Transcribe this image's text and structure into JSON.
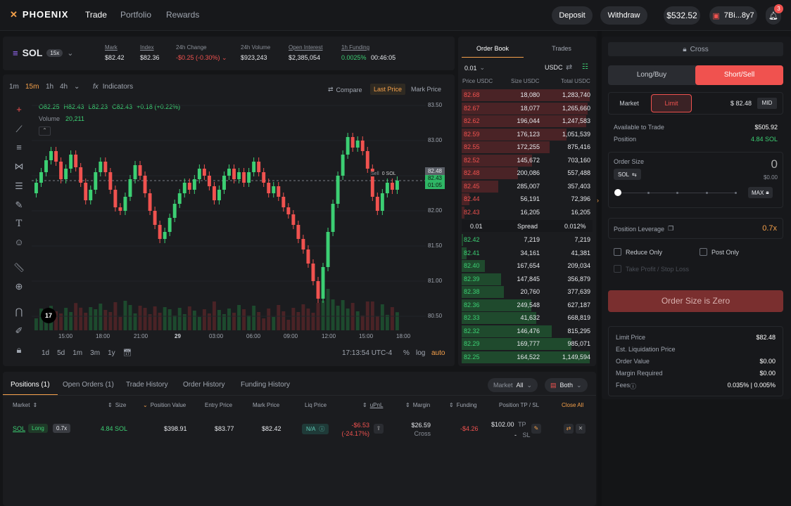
{
  "brand": {
    "name": "PHOENIX",
    "icon": "phoenix-logo-icon"
  },
  "nav": [
    {
      "label": "Trade"
    },
    {
      "label": "Portfolio"
    },
    {
      "label": "Rewards"
    }
  ],
  "top": {
    "deposit": "Deposit",
    "withdraw": "Withdraw",
    "balance": "$532.52",
    "wallet": "7Bi...8y7",
    "notifications": "3"
  },
  "market": {
    "symbol": "SOL",
    "leverage": "15x",
    "stats": [
      {
        "label": "Mark",
        "value": "$82.42"
      },
      {
        "label": "Index",
        "value": "$82.36"
      },
      {
        "label": "24h Change",
        "value": "-$0.25 (-0.30%)"
      },
      {
        "label": "24h Volume",
        "value": "$923,243"
      },
      {
        "label": "Open Interest",
        "value": "$2,385,054"
      },
      {
        "label": "1h Funding",
        "value": "0.0025%",
        "countdown": "00:46:05"
      }
    ]
  },
  "chart": {
    "timeframes": [
      "1m",
      "15m",
      "1h",
      "4h"
    ],
    "active_timeframe": "15m",
    "indicators": "Indicators",
    "compare": "Compare",
    "last_price": "Last Price",
    "mark_price": "Mark Price",
    "ohlc": {
      "o": "O82.25",
      "h": "H82.43",
      "l": "L82.23",
      "c": "C82.43",
      "chg": "+0.18 (+0.22%)"
    },
    "volume_label": "Volume",
    "volume_value": "20,211",
    "position_label": "Sell",
    "position_size": "0 SOL",
    "price_tag": "82.48",
    "last_tag": "82.43",
    "last_countdown": "01:05",
    "ranges": [
      "1d",
      "5d",
      "1m",
      "3m",
      "1y"
    ],
    "clock": "17:13:54 UTC-4",
    "pct": "%",
    "log": "log",
    "auto": "auto",
    "tv_logo": "17"
  },
  "chart_data": {
    "type": "candlestick",
    "y_ticks": [
      "83.50",
      "83.00",
      "82.50",
      "82.00",
      "81.50",
      "81.00",
      "80.50"
    ],
    "x_ticks": [
      "15:00",
      "18:00",
      "21:00",
      "29",
      "03:00",
      "06:00",
      "09:00",
      "12:00",
      "15:00",
      "18:00"
    ],
    "ylim": [
      80.3,
      83.6
    ],
    "series": [
      {
        "o": 82.25,
        "c": 82.4
      },
      {
        "o": 82.4,
        "c": 82.55
      },
      {
        "o": 82.55,
        "c": 82.72
      },
      {
        "o": 82.72,
        "c": 82.85
      },
      {
        "o": 82.85,
        "c": 82.7
      },
      {
        "o": 82.7,
        "c": 82.45
      },
      {
        "o": 82.45,
        "c": 82.6
      },
      {
        "o": 82.6,
        "c": 82.8
      },
      {
        "o": 82.8,
        "c": 82.62
      },
      {
        "o": 82.62,
        "c": 82.4
      },
      {
        "o": 82.4,
        "c": 82.15
      },
      {
        "o": 82.15,
        "c": 82.3
      },
      {
        "o": 82.3,
        "c": 82.55
      },
      {
        "o": 82.55,
        "c": 82.7
      },
      {
        "o": 82.7,
        "c": 82.55
      },
      {
        "o": 82.55,
        "c": 82.3
      },
      {
        "o": 82.3,
        "c": 82.05
      },
      {
        "o": 82.05,
        "c": 82.0
      },
      {
        "o": 82.0,
        "c": 82.2
      },
      {
        "o": 82.2,
        "c": 82.45
      },
      {
        "o": 82.45,
        "c": 82.65
      },
      {
        "o": 82.65,
        "c": 82.5
      },
      {
        "o": 82.5,
        "c": 82.25
      },
      {
        "o": 82.25,
        "c": 82.0
      },
      {
        "o": 82.0,
        "c": 81.8
      },
      {
        "o": 81.8,
        "c": 81.6
      },
      {
        "o": 81.6,
        "c": 81.7
      },
      {
        "o": 81.7,
        "c": 81.9
      },
      {
        "o": 81.9,
        "c": 82.1
      },
      {
        "o": 82.1,
        "c": 82.25
      },
      {
        "o": 82.25,
        "c": 82.4
      },
      {
        "o": 82.4,
        "c": 82.3
      },
      {
        "o": 82.3,
        "c": 82.45
      },
      {
        "o": 82.45,
        "c": 82.6
      },
      {
        "o": 82.6,
        "c": 82.5
      },
      {
        "o": 82.5,
        "c": 82.35
      },
      {
        "o": 82.35,
        "c": 82.15
      },
      {
        "o": 82.15,
        "c": 82.3
      },
      {
        "o": 82.3,
        "c": 82.5
      },
      {
        "o": 82.5,
        "c": 82.6
      },
      {
        "o": 82.6,
        "c": 82.45
      },
      {
        "o": 82.45,
        "c": 82.55
      },
      {
        "o": 82.55,
        "c": 82.4
      },
      {
        "o": 82.4,
        "c": 82.55
      },
      {
        "o": 82.55,
        "c": 82.7
      },
      {
        "o": 82.7,
        "c": 82.55
      },
      {
        "o": 82.55,
        "c": 82.4
      },
      {
        "o": 82.4,
        "c": 82.25
      },
      {
        "o": 82.25,
        "c": 82.35
      },
      {
        "o": 82.35,
        "c": 82.2
      },
      {
        "o": 82.2,
        "c": 82.05
      },
      {
        "o": 82.05,
        "c": 81.95
      },
      {
        "o": 81.95,
        "c": 81.8
      },
      {
        "o": 81.8,
        "c": 81.6
      },
      {
        "o": 81.6,
        "c": 81.45
      },
      {
        "o": 81.45,
        "c": 81.25
      },
      {
        "o": 81.25,
        "c": 81.0
      },
      {
        "o": 81.0,
        "c": 80.75
      },
      {
        "o": 80.75,
        "c": 81.2
      },
      {
        "o": 81.2,
        "c": 81.7
      },
      {
        "o": 81.7,
        "c": 82.1
      },
      {
        "o": 82.1,
        "c": 82.5
      },
      {
        "o": 82.5,
        "c": 82.8
      },
      {
        "o": 82.8,
        "c": 83.05
      },
      {
        "o": 83.05,
        "c": 82.9
      },
      {
        "o": 82.9,
        "c": 83.0
      },
      {
        "o": 83.0,
        "c": 82.85
      },
      {
        "o": 82.85,
        "c": 82.6
      },
      {
        "o": 82.6,
        "c": 82.2
      },
      {
        "o": 82.2,
        "c": 82.0
      },
      {
        "o": 82.0,
        "c": 82.25
      },
      {
        "o": 82.25,
        "c": 82.4
      },
      {
        "o": 82.4,
        "c": 82.3
      },
      {
        "o": 82.3,
        "c": 82.43
      }
    ]
  },
  "orderbook": {
    "tabs": [
      "Order Book",
      "Trades"
    ],
    "tick": "0.01",
    "currency": "USDC",
    "headers": [
      "Price USDC",
      "Size USDC",
      "Total USDC"
    ],
    "asks": [
      {
        "price": "82.68",
        "size": "18,080",
        "total": "1,283,740",
        "depth": 0.98
      },
      {
        "price": "82.67",
        "size": "18,077",
        "total": "1,265,660",
        "depth": 0.96
      },
      {
        "price": "82.62",
        "size": "196,044",
        "total": "1,247,583",
        "depth": 0.95
      },
      {
        "price": "82.59",
        "size": "176,123",
        "total": "1,051,539",
        "depth": 0.8
      },
      {
        "price": "82.55",
        "size": "172,255",
        "total": "875,416",
        "depth": 0.67
      },
      {
        "price": "82.52",
        "size": "145,672",
        "total": "703,160",
        "depth": 0.54
      },
      {
        "price": "82.48",
        "size": "200,086",
        "total": "557,488",
        "depth": 0.43
      },
      {
        "price": "82.45",
        "size": "285,007",
        "total": "357,403",
        "depth": 0.28
      },
      {
        "price": "82.44",
        "size": "56,191",
        "total": "72,396",
        "depth": 0.06
      },
      {
        "price": "82.43",
        "size": "16,205",
        "total": "16,205",
        "depth": 0.02
      }
    ],
    "spread": {
      "tick": "0.01",
      "label": "Spread",
      "pct": "0.012%"
    },
    "bids": [
      {
        "price": "82.42",
        "size": "7,219",
        "total": "7,219",
        "depth": 0.01
      },
      {
        "price": "82.41",
        "size": "34,161",
        "total": "41,381",
        "depth": 0.04
      },
      {
        "price": "82.40",
        "size": "167,654",
        "total": "209,034",
        "depth": 0.18
      },
      {
        "price": "82.39",
        "size": "147,845",
        "total": "356,879",
        "depth": 0.3
      },
      {
        "price": "82.38",
        "size": "20,760",
        "total": "377,639",
        "depth": 0.32
      },
      {
        "price": "82.36",
        "size": "249,548",
        "total": "627,187",
        "depth": 0.53
      },
      {
        "price": "82.33",
        "size": "41,632",
        "total": "668,819",
        "depth": 0.57
      },
      {
        "price": "82.32",
        "size": "146,476",
        "total": "815,295",
        "depth": 0.69
      },
      {
        "price": "82.29",
        "size": "169,777",
        "total": "985,071",
        "depth": 0.84
      },
      {
        "price": "82.25",
        "size": "164,522",
        "total": "1,149,594",
        "depth": 0.98
      }
    ]
  },
  "form": {
    "margin_mode": "Cross",
    "long": "Long/Buy",
    "short": "Short/Sell",
    "order_types": [
      "Market",
      "Limit"
    ],
    "price": "$ 82.48",
    "mid": "MID",
    "available_label": "Available to Trade",
    "available": "$505.92",
    "position_label": "Position",
    "position": "4.84 SOL",
    "order_size_label": "Order Size",
    "order_size": "0",
    "size_unit": "SOL",
    "size_usd": "$0.00",
    "max": "MAX",
    "slider_percent": 0,
    "leverage_label": "Position Leverage",
    "leverage": "0.7x",
    "reduce_only": "Reduce Only",
    "post_only": "Post Only",
    "tpsl": "Take Profit / Stop Loss",
    "submit": "Order Size is Zero",
    "summary": [
      {
        "label": "Limit Price",
        "value": "$82.48"
      },
      {
        "label": "Est. Liquidation Price",
        "value": ""
      },
      {
        "label": "Order Value",
        "value": "$0.00"
      },
      {
        "label": "Margin Required",
        "value": "$0.00"
      },
      {
        "label": "Fees",
        "value": "0.035% | 0.005%"
      }
    ]
  },
  "bottom": {
    "tabs": [
      "Positions (1)",
      "Open Orders (1)",
      "Trade History",
      "Order History",
      "Funding History"
    ],
    "filter_market": "Market",
    "filter_all": "All",
    "filter_side": "Both",
    "headers": [
      "Market",
      "Size",
      "Position Value",
      "Entry Price",
      "Mark Price",
      "Liq Price",
      "uPnL",
      "Margin",
      "Funding",
      "Position TP / SL",
      "Close All"
    ],
    "row": {
      "market": "SOL",
      "side": "Long",
      "lev": "0.7x",
      "size": "4.84 SOL",
      "value": "$398.91",
      "entry": "$83.77",
      "mark": "$82.42",
      "liq": "N/A",
      "upnl": "-$6.53",
      "upnl_pct": "(-24.17%)",
      "margin": "$26.59",
      "margin_mode": "Cross",
      "funding": "-$4.26",
      "tp": "$102.00",
      "tp_label": "TP",
      "sl": "-",
      "sl_label": "SL"
    }
  },
  "colors": {
    "accent": "#f5a04a",
    "up": "#3ccf73",
    "down": "#f0524f",
    "short_button": "#f0524f",
    "submit_bg": "#7a2f2f"
  }
}
